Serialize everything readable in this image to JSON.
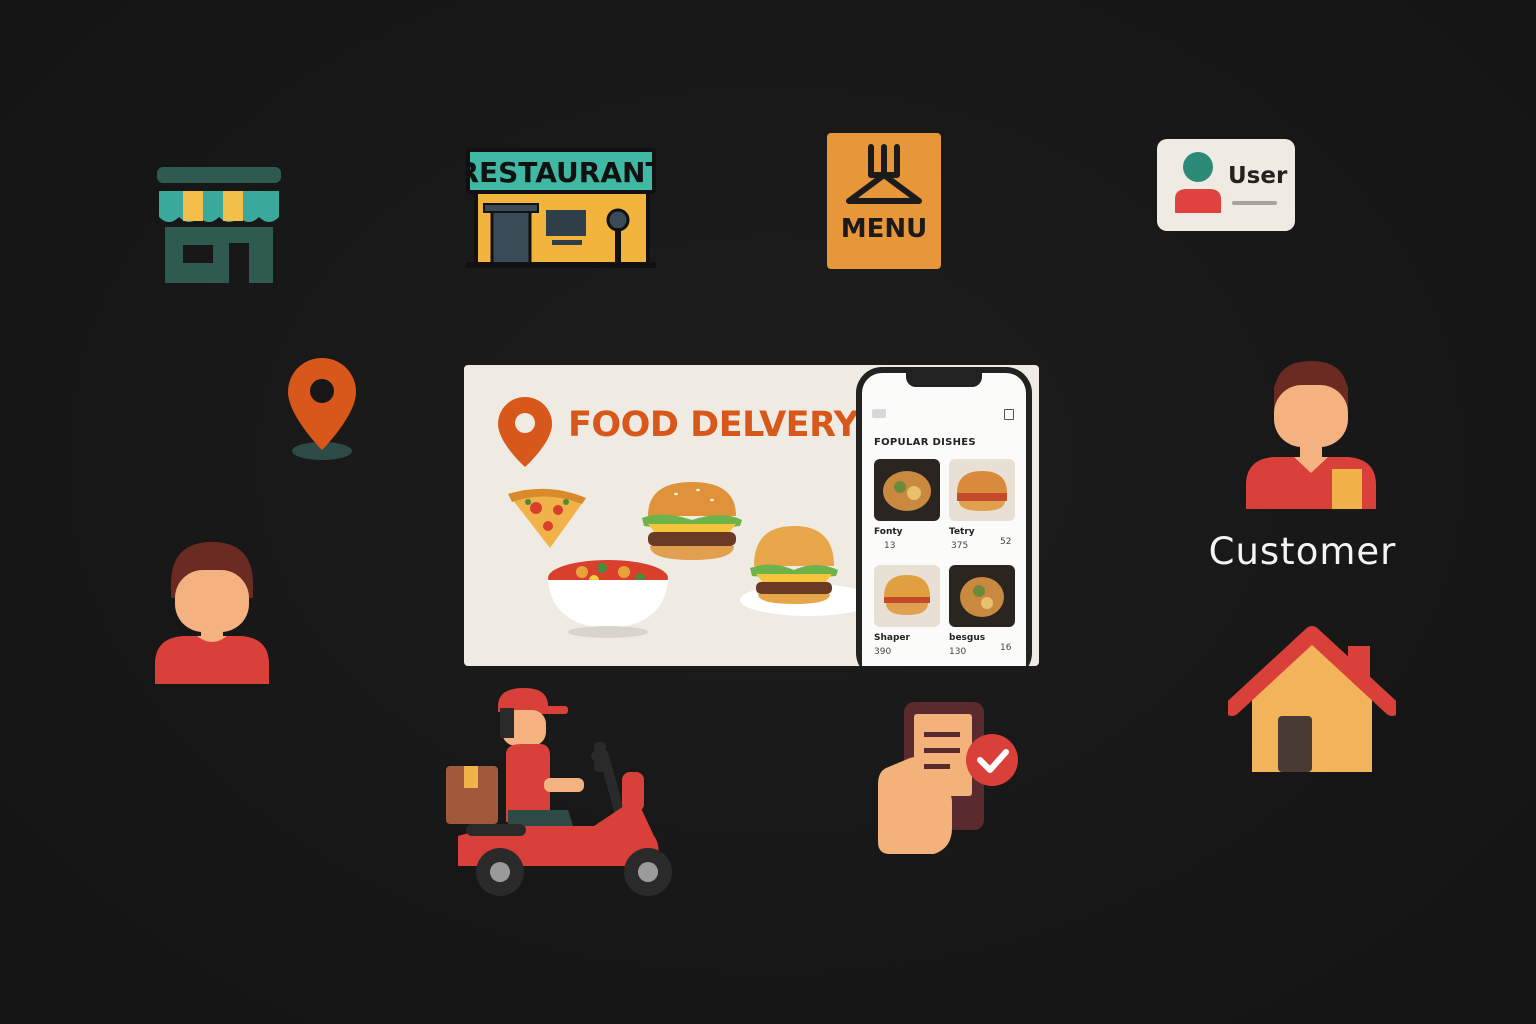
{
  "banner": {
    "title": "FOOD DELVERY",
    "phone": {
      "section_title": "FOPULAR DISHES",
      "dishes": [
        {
          "name": "Fonty",
          "price": "13",
          "extra": ""
        },
        {
          "name": "Tetry",
          "price": "375",
          "extra": "52"
        },
        {
          "name": "Shaper",
          "price": "390",
          "extra": ""
        },
        {
          "name": "besgus",
          "price": "130",
          "extra": "16"
        }
      ]
    }
  },
  "icons": {
    "restaurant_sign": "RESTAURANT",
    "menu_label": "MENU",
    "user_card_label": "User",
    "customer_label": "Customer",
    "names": [
      "store-icon",
      "restaurant-icon",
      "menu-icon",
      "user-card-icon",
      "location-pin-icon",
      "person-icon",
      "customer-icon",
      "delivery-scooter-icon",
      "order-confirmed-phone-icon",
      "home-icon"
    ]
  },
  "colors": {
    "background": "#171717",
    "accent_orange": "#d8581c",
    "menu_orange": "#e8963a",
    "teal": "#3aa89a",
    "red": "#d9403a",
    "skin": "#f3b27f"
  }
}
